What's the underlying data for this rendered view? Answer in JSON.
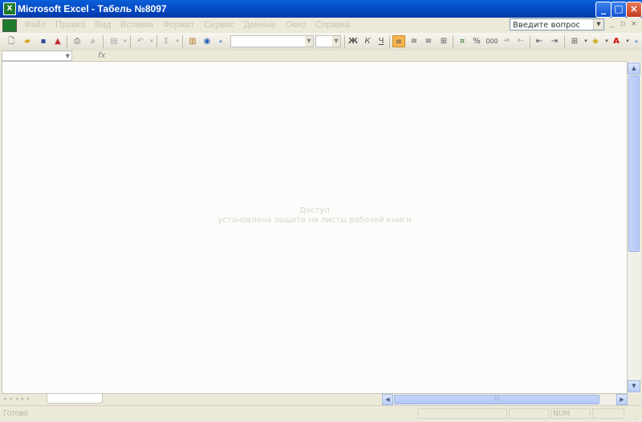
{
  "window": {
    "title": "Microsoft Excel - Табель №8097",
    "icon": "excel-icon",
    "min_label": "_",
    "max_label": "□",
    "close_label": "×"
  },
  "menu": {
    "items": [
      "Файл",
      "Правка",
      "Вид",
      "Вставка",
      "Формат",
      "Сервис",
      "Данные",
      "Окно",
      "Справка"
    ],
    "ask_placeholder": "Введите вопрос",
    "mdi_minimize": "_",
    "mdi_restore": "▫",
    "mdi_close": "×"
  },
  "toolbar": {
    "bold": "Ж",
    "italic": "К",
    "underline": "Ч",
    "percent": "%",
    "thousands": "000",
    "accent_color": "#f8b54d",
    "font_color": "#d00000"
  },
  "formula_bar": {
    "fx": "fx"
  },
  "sheet": {
    "protect_line1": "Доступ",
    "protect_line2": "установлена защита на листы рабочей книги"
  },
  "status": {
    "text": "Готово",
    "num": "NUM"
  }
}
